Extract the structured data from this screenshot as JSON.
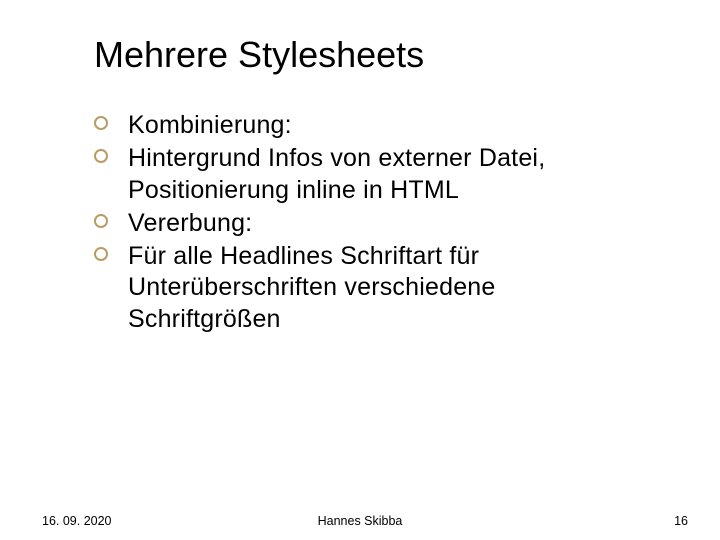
{
  "slide": {
    "title": "Mehrere Stylesheets",
    "bullets": [
      "Kombinierung:",
      "Hintergrund Infos von externer Datei, Positionierung inline in HTML",
      "Vererbung:",
      "Für alle Headlines Schriftart für Unterüberschriften verschiedene Schriftgrößen"
    ],
    "footer": {
      "date": "16. 09. 2020",
      "author": "Hannes Skibba",
      "page_number": "16"
    }
  }
}
